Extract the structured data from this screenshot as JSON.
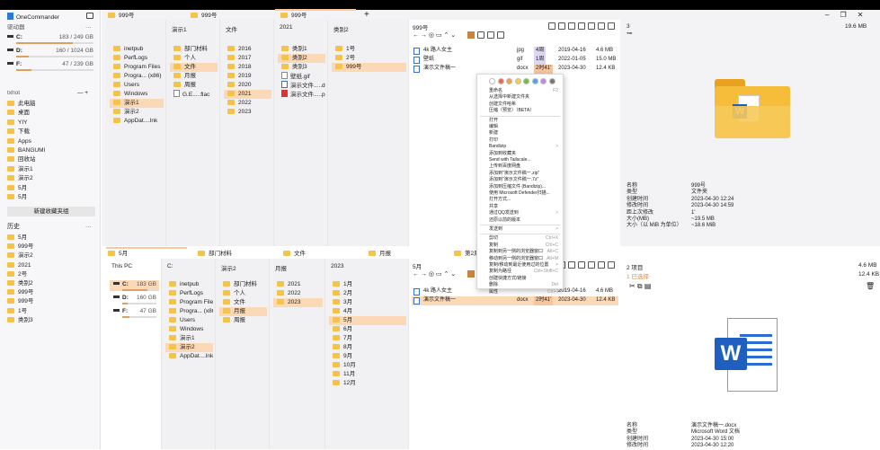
{
  "app": {
    "title": "OneCommander"
  },
  "sidebar": {
    "drives_label": "驱动器",
    "drives": [
      {
        "name": "C:",
        "usage": "183 / 249 GB",
        "fill": 0.73
      },
      {
        "name": "D:",
        "usage": "160 / 1024 GB",
        "fill": 0.16
      },
      {
        "name": "F:",
        "usage": "47 / 239 GB",
        "fill": 0.2
      }
    ],
    "group_label": "txhot",
    "favorites": [
      "此电脑",
      "桌面",
      "YIY",
      "下载",
      "Apps",
      "BANGUMI",
      "回收站",
      "演示1",
      "演示2",
      "5月",
      "5月"
    ],
    "new_group_button": "新建收藏夹组",
    "history_label": "历史",
    "history": [
      "5月",
      "999号",
      "演示2",
      "2021",
      "2号",
      "类别2",
      "999号",
      "999号",
      "1号",
      "类别3"
    ]
  },
  "top": {
    "tabs": [
      "999号",
      "999号",
      "999号"
    ],
    "columns": [
      {
        "header": "",
        "items": [
          "inetpub",
          "PerfLogs",
          "Program Files",
          "Progra... (x86)",
          "Users",
          "Windows",
          "演示1",
          "演示2",
          "AppDat....lnk"
        ],
        "selected": 6
      },
      {
        "header": "演示1",
        "items": [
          "部门材料",
          "个人",
          "文件",
          "月报",
          "周报",
          "G.E.....flac"
        ],
        "selected": 2
      },
      {
        "header": "文件",
        "items": [
          "2016",
          "2017",
          "2018",
          "2019",
          "2020",
          "2021",
          "2022",
          "2023"
        ],
        "selected": 5
      },
      {
        "header": "2021",
        "items": [
          "类别1",
          "类别2",
          "类别3",
          "壁纸.gif",
          "演示文件.....docx",
          "演示文件.....pdf"
        ],
        "selected": 1
      },
      {
        "header": "类别2",
        "items": [
          "1号",
          "2号",
          "999号"
        ],
        "selected": 2
      }
    ],
    "list": {
      "title": "999号",
      "count": "3 项目",
      "total": "19.6 MB",
      "files": [
        {
          "name": "4k 路人女主",
          "ext": "jpg",
          "age": "4周",
          "date": "2019-04-16",
          "size": "4.6 MB"
        },
        {
          "name": "壁纸",
          "ext": "gif",
          "age": "1周",
          "date": "2022-01-05",
          "size": "15.0 MB"
        },
        {
          "name": "演示文件稿一",
          "ext": "docx",
          "age": "2时41'",
          "date": "2023-04-30",
          "size": "12.4 KB"
        }
      ]
    },
    "info": [
      [
        "名称",
        "999号"
      ],
      [
        "类型",
        "文件夹"
      ],
      [
        "创建时间",
        "2023-04-30  12:24"
      ],
      [
        "修改时间",
        "2023-04-30  14:59"
      ],
      [
        "距上次修改",
        "1'"
      ],
      [
        "大小(MB)",
        "~19.5 MB"
      ],
      [
        "大小（以 MiB 为单位）",
        "~18.6 MiB"
      ]
    ]
  },
  "context_menu": {
    "colors": [
      "#ffffff",
      "#f0674f",
      "#f0a04b",
      "#f5cf4c",
      "#6cbf4c",
      "#4ea5ef",
      "#c08ae0",
      "#777777"
    ],
    "items": [
      {
        "label": "重命名",
        "shortcut": "F2"
      },
      {
        "label": "从选择中新建文件夹"
      },
      {
        "label": "创建文件哈希"
      },
      {
        "label": "压缩（预览）（BETA）"
      },
      {
        "label": "打开"
      },
      {
        "label": "编辑"
      },
      {
        "label": "新建"
      },
      {
        "label": "打印"
      },
      {
        "label": "Bandizip",
        "shortcut": ">"
      },
      {
        "label": "添加到收藏夹"
      },
      {
        "label": "Send with Tailscale..."
      },
      {
        "label": "上传到百度网盘"
      },
      {
        "label": "添加到\"演示文件稿一.zip\""
      },
      {
        "label": "添加到\"演示文件稿一.7z\""
      },
      {
        "label": "添加到压缩文件 (Bandizip)..."
      },
      {
        "label": "使用 Microsoft Defender扫描..."
      },
      {
        "label": "打开方式..."
      },
      {
        "label": "共享"
      },
      {
        "label": "通过QQ发送到",
        "shortcut": ">"
      },
      {
        "label": "还原以前的版本"
      },
      {
        "label": "发送到",
        "shortcut": ">"
      },
      {
        "label": "剪切",
        "shortcut": "Ctrl+X"
      },
      {
        "label": "复制",
        "shortcut": "Ctrl+C"
      },
      {
        "label": "复制到另一侧的浏览器窗口",
        "shortcut": "Alt+C"
      },
      {
        "label": "移动到另一侧的浏览器窗口",
        "shortcut": "Alt+M"
      },
      {
        "label": "复制/移动到最近使用过的位置",
        "shortcut": ">"
      },
      {
        "label": "复制为路径",
        "shortcut": "Ctrl+Shift+C"
      },
      {
        "label": "创建快捷方式/链接"
      },
      {
        "label": "删除",
        "shortcut": "Del"
      },
      {
        "label": "属性",
        "shortcut": "Ctrl+I"
      }
    ]
  },
  "bottom": {
    "tabs": [
      "5月",
      "部门材料",
      "文件",
      "月报",
      "第2周"
    ],
    "pc_header": "This PC",
    "drives": [
      {
        "name": "C:",
        "size": "183 GB",
        "fill": 0.73
      },
      {
        "name": "D:",
        "size": "160 GB",
        "fill": 0.16
      },
      {
        "name": "F:",
        "size": "47 GB",
        "fill": 0.2
      }
    ],
    "columns": [
      {
        "header": "C:",
        "items": [
          "inetpub",
          "PerfLogs",
          "Program Files",
          "Progra... (x86)",
          "Users",
          "Windows",
          "演示1",
          "演示2",
          "AppDat....lnk"
        ],
        "selected": 7
      },
      {
        "header": "演示2",
        "items": [
          "部门材料",
          "个人",
          "文件",
          "月报",
          "周报"
        ],
        "selected": 3
      },
      {
        "header": "月报",
        "items": [
          "2021",
          "2022",
          "2023"
        ],
        "selected": 2
      },
      {
        "header": "2023",
        "items": [
          "1月",
          "2月",
          "3月",
          "4月",
          "5月",
          "6月",
          "7月",
          "8月",
          "9月",
          "10月",
          "11月",
          "12月"
        ],
        "selected": 4
      }
    ],
    "list": {
      "title": "5月",
      "count": "2 项目",
      "total": "4.6 MB",
      "selected_count": "1 已选择",
      "selected_size": "12.4 KB",
      "files": [
        {
          "name": "4k 路人女主",
          "ext": "",
          "age": "",
          "date": "2019-04-16",
          "size": "4.6 MB"
        },
        {
          "name": "演示文件稿一",
          "ext": "docx",
          "age": "2时41'",
          "date": "2023-04-30",
          "size": "12.4 KB"
        }
      ]
    },
    "info": [
      [
        "名称",
        "演示文件稿一.docx"
      ],
      [
        "类型",
        "Microsoft Word 文档"
      ],
      [
        "创建时间",
        "2023-04-30  15:00"
      ],
      [
        "修改时间",
        "2023-04-30  12:20"
      ]
    ]
  }
}
